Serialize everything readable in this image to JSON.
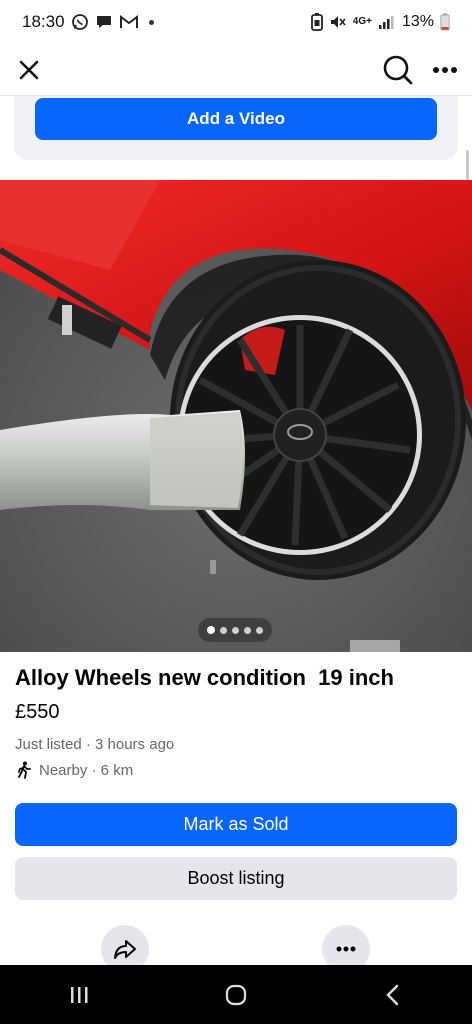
{
  "status_bar": {
    "time": "18:30",
    "battery_percent": "13%",
    "network": "4G+",
    "icons": [
      "whatsapp-icon",
      "chat-icon",
      "gmail-icon",
      "notification-dot",
      "battery-saver-icon",
      "mute-icon",
      "signal-icon",
      "battery-icon"
    ]
  },
  "header": {
    "close_icon": "close-icon",
    "search_icon": "search-icon",
    "more_icon": "more-icon"
  },
  "add_video": {
    "label": "Add a Video"
  },
  "photo": {
    "description_icon": "car-wheel-photo",
    "image_count": 5,
    "active_index": 0
  },
  "listing": {
    "title": "Alloy Wheels new condition  19 inch",
    "price": "£550",
    "listed_text": "Just listed · 3 hours ago",
    "location_text": "Nearby · 6 km"
  },
  "actions": {
    "mark_sold_label": "Mark as Sold",
    "boost_label": "Boost listing",
    "share_icon": "share-icon",
    "more_icon": "more-icon"
  },
  "nav_bar": {
    "recents_icon": "recents-icon",
    "home_icon": "home-icon",
    "back_icon": "back-icon"
  },
  "colors": {
    "brand_blue": "#0866ff",
    "secondary_gray": "#e4e6eb",
    "meta_text": "#65676b"
  }
}
